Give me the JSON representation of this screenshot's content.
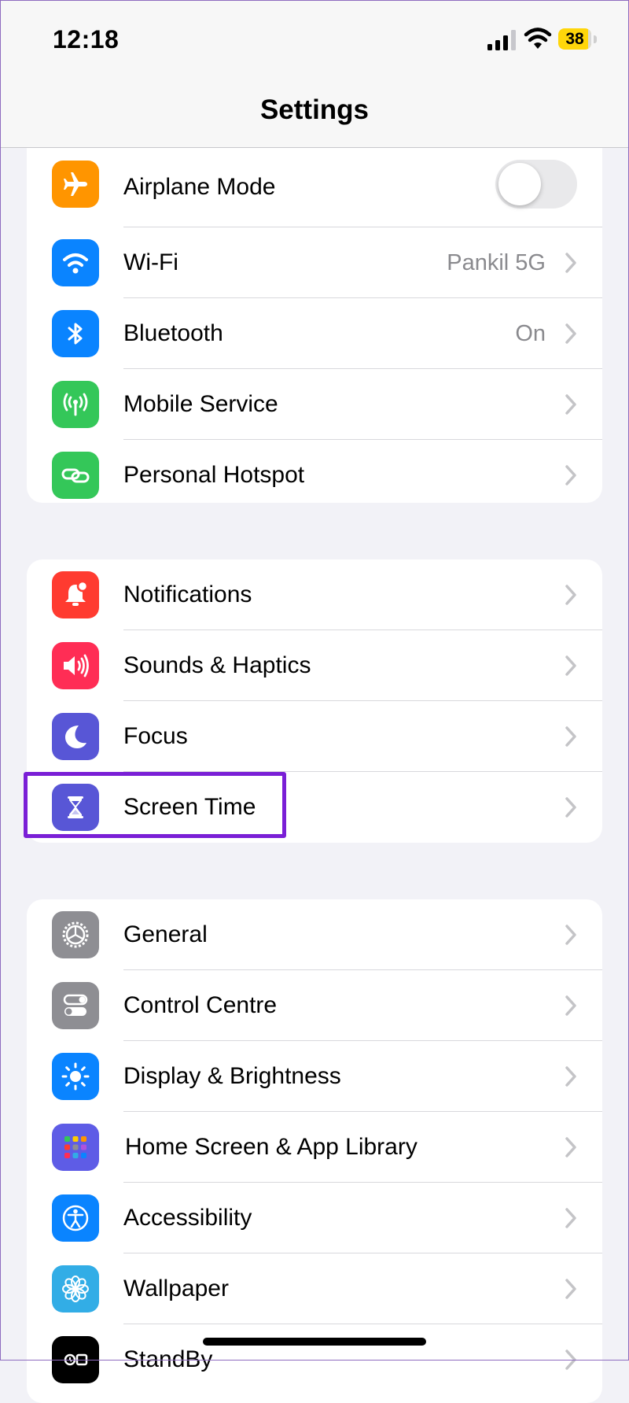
{
  "status_bar": {
    "time": "12:18",
    "battery": "38"
  },
  "nav": {
    "title": "Settings"
  },
  "groups": [
    {
      "rows": [
        {
          "label": "Airplane Mode",
          "icon": "airplane-icon",
          "color": "#ff9500",
          "control": "toggle",
          "toggle_on": false
        },
        {
          "label": "Wi-Fi",
          "icon": "wifi-icon",
          "color": "#0a84ff",
          "value": "Pankil 5G"
        },
        {
          "label": "Bluetooth",
          "icon": "bluetooth-icon",
          "color": "#0a84ff",
          "value": "On"
        },
        {
          "label": "Mobile Service",
          "icon": "antenna-icon",
          "color": "#34c759"
        },
        {
          "label": "Personal Hotspot",
          "icon": "hotspot-icon",
          "color": "#34c759"
        }
      ]
    },
    {
      "rows": [
        {
          "label": "Notifications",
          "icon": "bell-icon",
          "color": "#ff3b30"
        },
        {
          "label": "Sounds & Haptics",
          "icon": "speaker-icon",
          "color": "#ff2d55"
        },
        {
          "label": "Focus",
          "icon": "moon-icon",
          "color": "#5856d6"
        },
        {
          "label": "Screen Time",
          "icon": "hourglass-icon",
          "color": "#5856d6",
          "highlighted": true
        }
      ]
    },
    {
      "rows": [
        {
          "label": "General",
          "icon": "gear-icon",
          "color": "#8e8e93"
        },
        {
          "label": "Control Centre",
          "icon": "toggles-icon",
          "color": "#8e8e93"
        },
        {
          "label": "Display & Brightness",
          "icon": "sun-icon",
          "color": "#0a84ff"
        },
        {
          "label": "Home Screen & App Library",
          "icon": "app-grid-icon",
          "color": "#5e5ce6"
        },
        {
          "label": "Accessibility",
          "icon": "accessibility-icon",
          "color": "#0a84ff"
        },
        {
          "label": "Wallpaper",
          "icon": "flower-icon",
          "color": "#32ade6"
        },
        {
          "label": "StandBy",
          "icon": "standby-icon",
          "color": "#000000"
        }
      ]
    }
  ],
  "colors": {
    "highlight": "#7a1fd6",
    "background": "#f2f2f7"
  }
}
